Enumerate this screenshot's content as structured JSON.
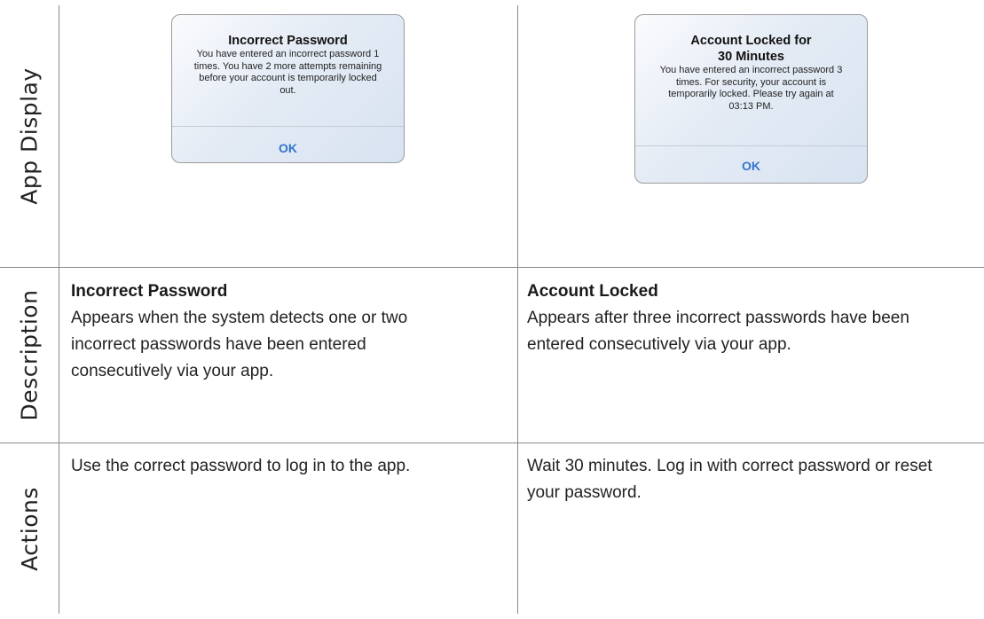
{
  "rows": {
    "app_display": "App Display",
    "description": "Description",
    "actions": "Actions"
  },
  "incorrect": {
    "alert_title": "Incorrect Password",
    "alert_message": "You have entered an incorrect password 1 times. You have 2 more attempts remaining before your account is temporarily locked out.",
    "alert_button": "OK",
    "desc_title": "Incorrect Password",
    "desc_text": "Appears when the system detects one or two incorrect passwords have been entered consecutively via your app.",
    "action_text": "Use the correct password to log in to the app."
  },
  "locked": {
    "alert_title": "Account Locked for 30 Minutes",
    "alert_message": "You have entered an incorrect password 3 times. For security, your account is temporarily locked. Please try again at 03:13 PM.",
    "alert_button": "OK",
    "desc_title": "Account Locked",
    "desc_text": "Appears after three incorrect passwords have been entered consecutively via your app.",
    "action_text": "Wait 30 minutes. Log in with correct password or reset your password."
  },
  "colors": {
    "grid": "#8a8a8a",
    "alert_button": "#3476c8",
    "alert_background": "#e4ebf5"
  }
}
